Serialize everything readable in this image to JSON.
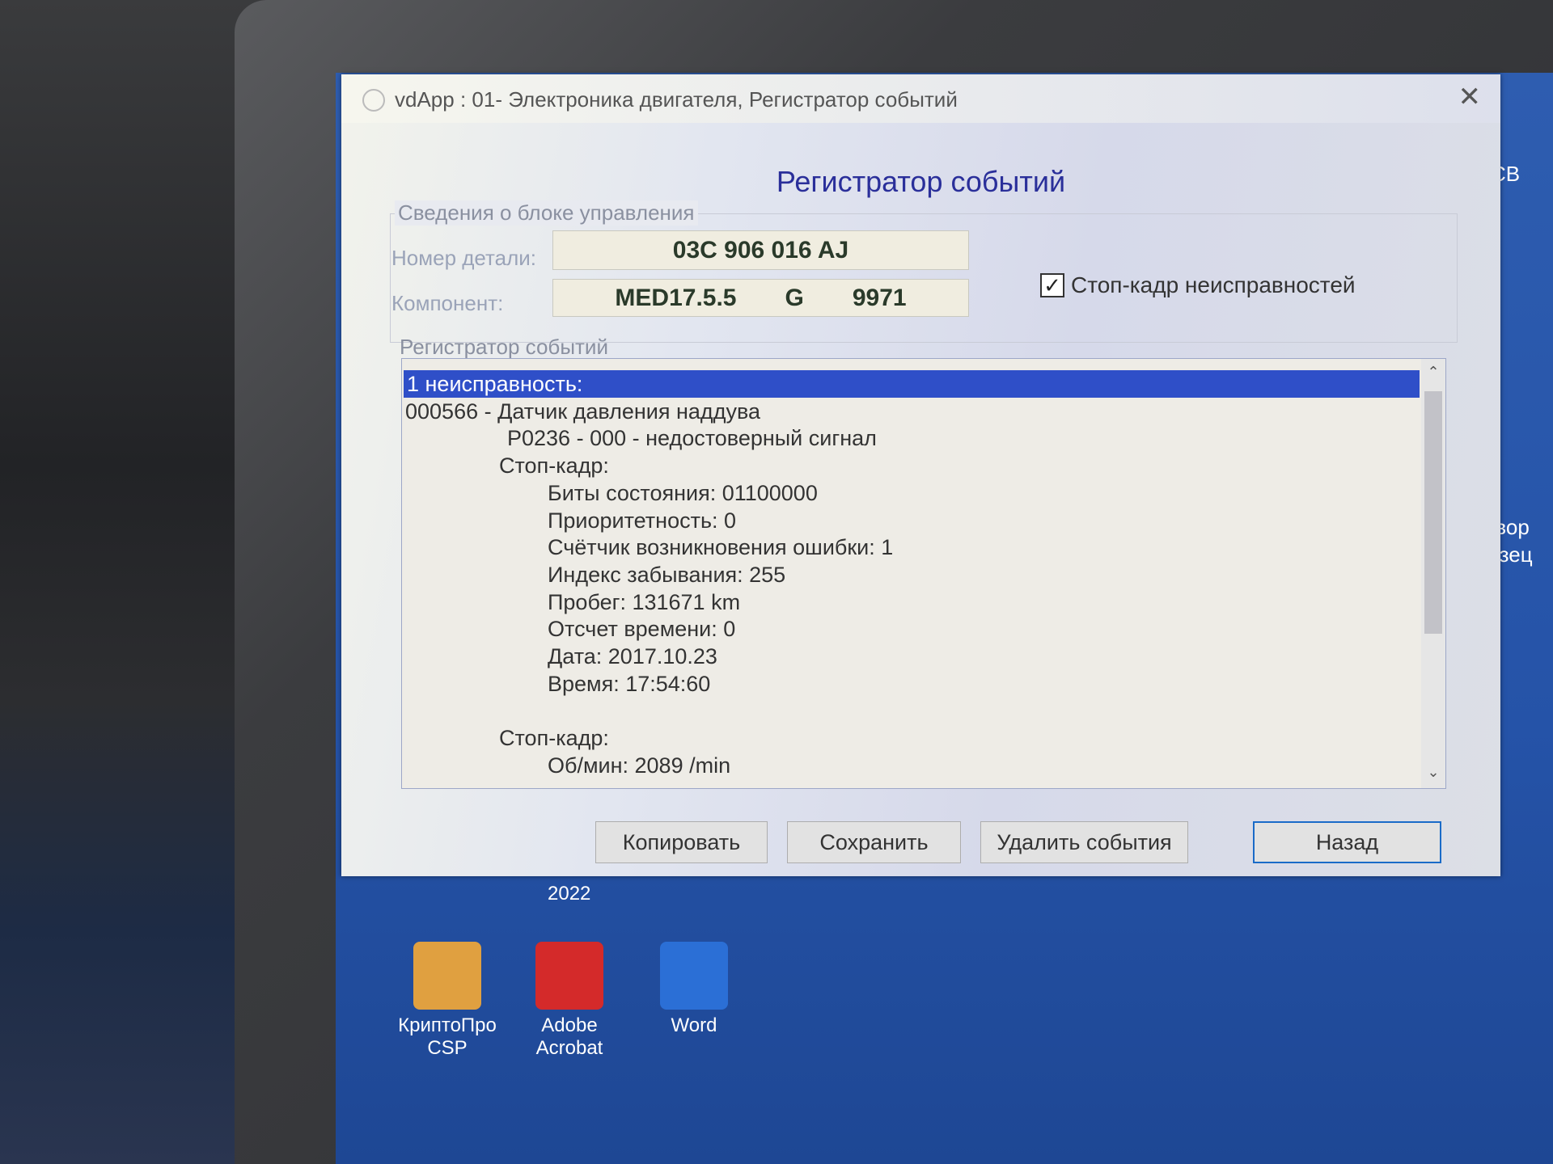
{
  "window": {
    "title": "vdApp : 01- Электроника двигателя,  Регистратор событий",
    "close": "✕"
  },
  "header": "Регистратор событий",
  "control_unit": {
    "group_label": "Сведения о блоке управления",
    "part_label": "Номер детали:",
    "part_value": "03C 906 016 AJ",
    "component_label": "Компонент:",
    "component_values": [
      "MED17.5.5",
      "G",
      "9971"
    ],
    "freeze_frame_checkbox": {
      "label": "Стоп-кадр неисправностей",
      "checked": true
    }
  },
  "event_log": {
    "group_label": "Регистратор событий",
    "rows": [
      {
        "text": "1 неисправность:",
        "indent": 0,
        "selected": true
      },
      {
        "text": "000566 - Датчик давления наддува",
        "indent": 0
      },
      {
        "text": "P0236 - 000 - недостоверный сигнал",
        "indent": 2
      },
      {
        "text": "Стоп-кадр:",
        "indent": 1
      },
      {
        "text": "Биты состояния: 01100000",
        "indent": 3
      },
      {
        "text": "Приоритетность: 0",
        "indent": 3
      },
      {
        "text": "Счётчик возникновения ошибки: 1",
        "indent": 3
      },
      {
        "text": "Индекс забывания: 255",
        "indent": 3
      },
      {
        "text": "Пробег: 131671 km",
        "indent": 3
      },
      {
        "text": "Отсчет времени: 0",
        "indent": 3
      },
      {
        "text": "Дата: 2017.10.23",
        "indent": 3
      },
      {
        "text": "Время: 17:54:60",
        "indent": 3
      },
      {
        "text": "",
        "indent": 0
      },
      {
        "text": "Стоп-кадр:",
        "indent": 1
      },
      {
        "text": "Об/мин: 2089 /min",
        "indent": 3
      }
    ]
  },
  "buttons": {
    "copy": "Копировать",
    "save": "Сохранить",
    "delete": "Удалить события",
    "back": "Назад"
  },
  "desktop": {
    "partial_label": "2022",
    "icons": [
      {
        "label": "КриптоПро CSP",
        "color": "#e0a040"
      },
      {
        "label": "Adobe Acrobat",
        "color": "#d42a2a"
      },
      {
        "label": "Word",
        "color": "#2b6fd6"
      }
    ],
    "right_partial": [
      "СВ",
      "говор",
      "разец"
    ]
  }
}
